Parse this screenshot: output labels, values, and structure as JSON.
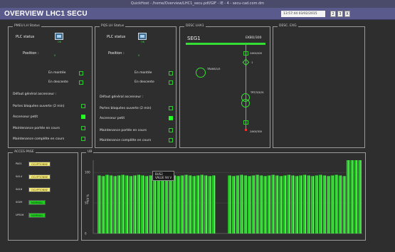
{
  "window": {
    "titlebar": "QuickHost - /home/Overview/LHC1_secu.pdf/GIF - IE - 4 - secu-cad.com.dm",
    "title": "OVERVIEW LHC1 SECU",
    "date": "13:57:44  03/02/2015",
    "buttons": [
      "2",
      "3",
      "X"
    ]
  },
  "panel1": {
    "legend": "PMEU LH Status",
    "plc_label": "PLC status",
    "plc_ok": "OK",
    "position_label": "Position :",
    "position_value": "0",
    "en_montee": "En montée",
    "en_descente": "En descente",
    "defaut": "Défaut général ascenseur :",
    "portes": "Portes bloquées ouverte (2 min)",
    "ascenseur": "Ascenseur petit",
    "maint1": "Maintenance portée en cours",
    "maint2": "Maintenance complète en cours"
  },
  "panel2": {
    "legend": "PQS LH Status",
    "plc_label": "PLC status",
    "plc_ok": "OK",
    "position_label": "Position :",
    "position_value": "0",
    "en_montee": "En montée",
    "en_descente": "En descente",
    "defaut": "Défaut général ascenseur :",
    "portes": "Portes bloquées ouverte (2 min)",
    "ascenseur": "Ascenseur petit",
    "maint1": "Maintenance portée en cours",
    "maint2": "Maintenance complète en cours"
  },
  "panel3": {
    "legend": "DESC LHA1",
    "seg_label": "SEG1",
    "seg_id": "EKBO/300",
    "top_breaker": "24KV/400",
    "trans_label": "TRANS/1/5",
    "mid_breaker": "1",
    "low_label": "TRT/3/3/01",
    "bottom_label": "24KV/300"
  },
  "panel4": {
    "legend": "DESC. EXG"
  },
  "panel5": {
    "legend": "ACCES PASE",
    "rows": [
      {
        "name": "PA01",
        "status": "OCUPTIONNE",
        "color": "yellow"
      },
      {
        "name": "SA14",
        "status": "OCUPTIONNE",
        "color": "yellow"
      },
      {
        "name": "SA16",
        "status": "OCUPTIONNE",
        "color": "yellow"
      },
      {
        "name": "SG09",
        "status": "NOMINAL",
        "color": "green"
      },
      {
        "name": "UP016",
        "status": "NOMINAL",
        "color": "green"
      }
    ]
  },
  "panel6": {
    "legend": "UB",
    "ylabel": "kV %",
    "tooltip_line1": "BUS2",
    "tooltip_line2": "VALUE 94 V"
  },
  "chart_data": {
    "type": "bar",
    "ylabel": "kV %",
    "ylim": [
      0,
      120
    ],
    "yticks": [
      "0",
      "50",
      "100"
    ],
    "values": [
      95,
      94,
      96,
      95,
      94,
      95,
      96,
      95,
      94,
      95,
      96,
      95,
      94,
      95,
      96,
      95,
      94,
      95,
      96,
      95,
      94,
      95,
      96,
      95,
      94,
      95,
      96,
      95,
      94,
      95,
      0,
      0,
      0,
      95,
      94,
      95,
      96,
      95,
      94,
      95,
      96,
      95,
      94,
      95,
      96,
      95,
      94,
      95,
      96,
      95,
      94,
      95,
      96,
      95,
      94,
      95,
      96,
      95,
      94,
      95,
      96,
      95,
      94,
      125,
      125,
      125,
      125
    ],
    "colors": {
      "bar": "#22cc22",
      "bar_light": "#88ee88",
      "grid": "#555555"
    }
  }
}
